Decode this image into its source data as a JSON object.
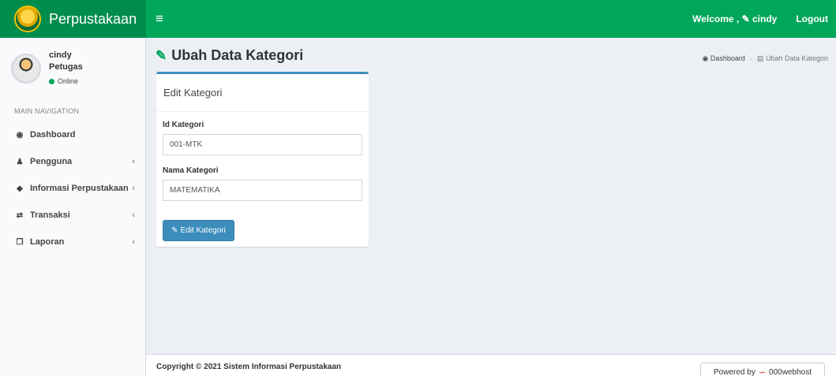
{
  "header": {
    "app_name": "Perpustakaan",
    "menu_toggle": "≡",
    "welcome": "Welcome ,",
    "user_icon": "✎",
    "user_name": "cindy",
    "logout": "Logout"
  },
  "user_panel": {
    "name": "cindy",
    "role": "Petugas",
    "status": "Online"
  },
  "sidebar": {
    "header": "MAIN NAVIGATION",
    "items": [
      {
        "label": "Dashboard",
        "icon": "dashboard-icon",
        "glyph": "◉",
        "chevron": ""
      },
      {
        "label": "Pengguna",
        "icon": "user-icon",
        "glyph": "♟",
        "chevron": "‹"
      },
      {
        "label": "Informasi Perpustakaan",
        "icon": "tag-icon",
        "glyph": "◆",
        "chevron": "‹"
      },
      {
        "label": "Transaksi",
        "icon": "exchange-icon",
        "glyph": "⇄",
        "chevron": "‹"
      },
      {
        "label": "Laporan",
        "icon": "copy-icon",
        "glyph": "❐",
        "chevron": "‹"
      }
    ]
  },
  "page": {
    "title": "Ubah Data Kategori",
    "title_icon": "✎",
    "breadcrumb": {
      "home": "Dashboard",
      "home_icon": "◉",
      "sep": "›",
      "current_icon": "▤",
      "current": "Ubah Data Kategori"
    }
  },
  "form": {
    "box_title": "Edit Kategori",
    "id_label": "Id Kategori",
    "id_value": "001-MTK",
    "name_label": "Nama Kategori",
    "name_value": "MATEMATIKA",
    "submit_label": "Edit Kategori",
    "submit_icon": "✎"
  },
  "footer": {
    "copyright": "Copyright © 2021 Sistem Informasi Perpustakaan",
    "powered_by": "Powered by",
    "host_icon": "∽",
    "host_name": "000webhost"
  },
  "colors": {
    "navbar": "#00a65a",
    "logo_bg": "#008d4c",
    "primary": "#3c8dbc"
  }
}
